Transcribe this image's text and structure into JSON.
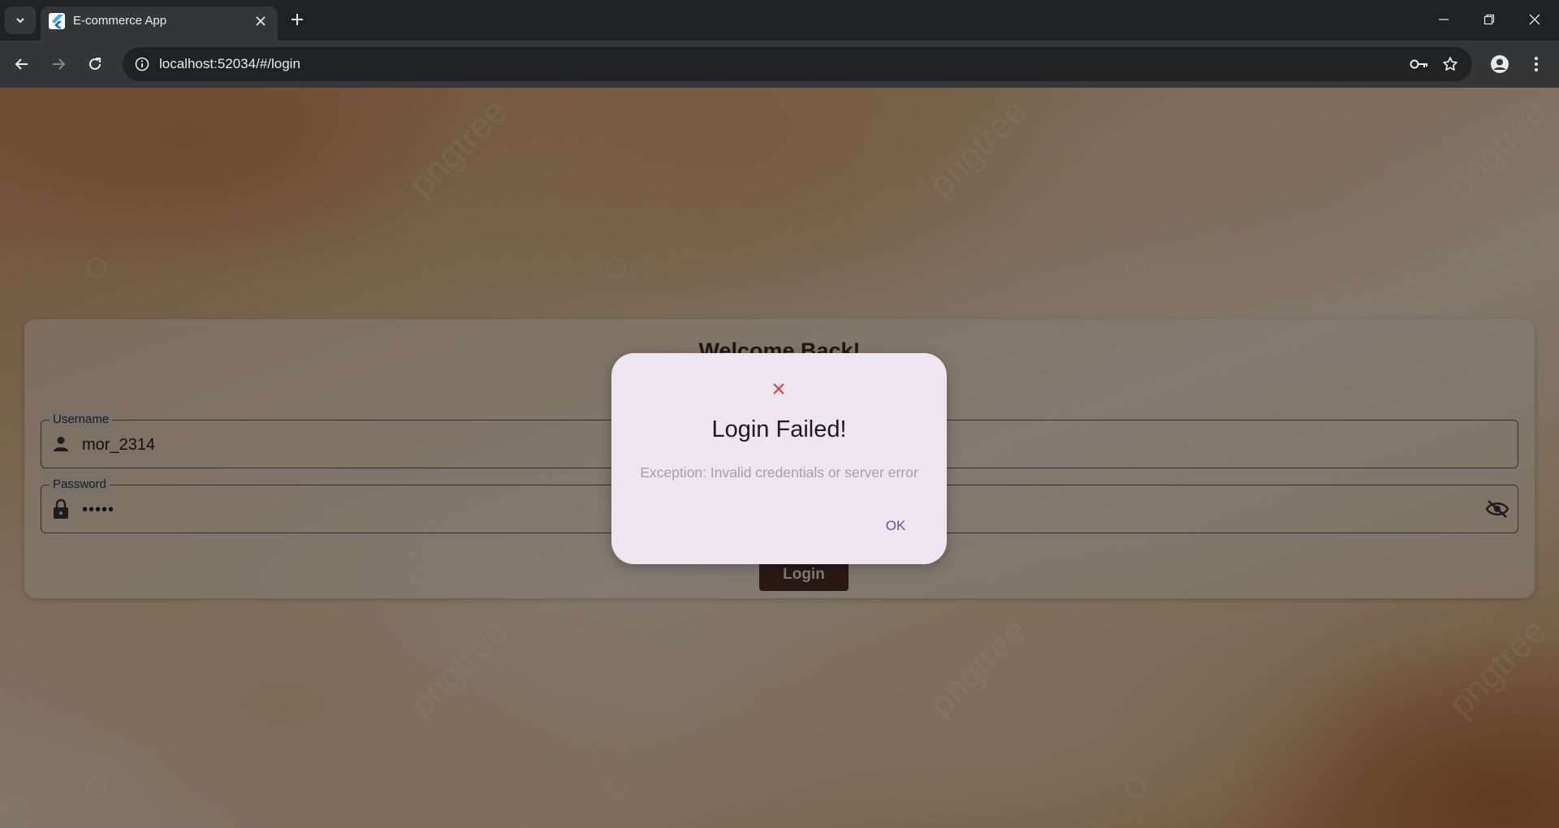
{
  "browser": {
    "tab_title": "E-commerce App",
    "url": "localhost:52034/#/login"
  },
  "page": {
    "title": "Welcome Back!",
    "username_label": "Username",
    "username_value": "mor_2314",
    "password_label": "Password",
    "password_value": "•••••",
    "login_label": "Login",
    "watermark_text": "pngtree"
  },
  "dialog": {
    "icon": "close-icon",
    "title": "Login Failed!",
    "message": "Exception: Invalid credentials or server error",
    "ok_label": "OK",
    "icon_color": "#e53935",
    "accent": "#6750a4"
  },
  "colors": {
    "chrome_dark": "#202124",
    "chrome_toolbar": "#35363a",
    "button_brown": "#4a2f25"
  }
}
